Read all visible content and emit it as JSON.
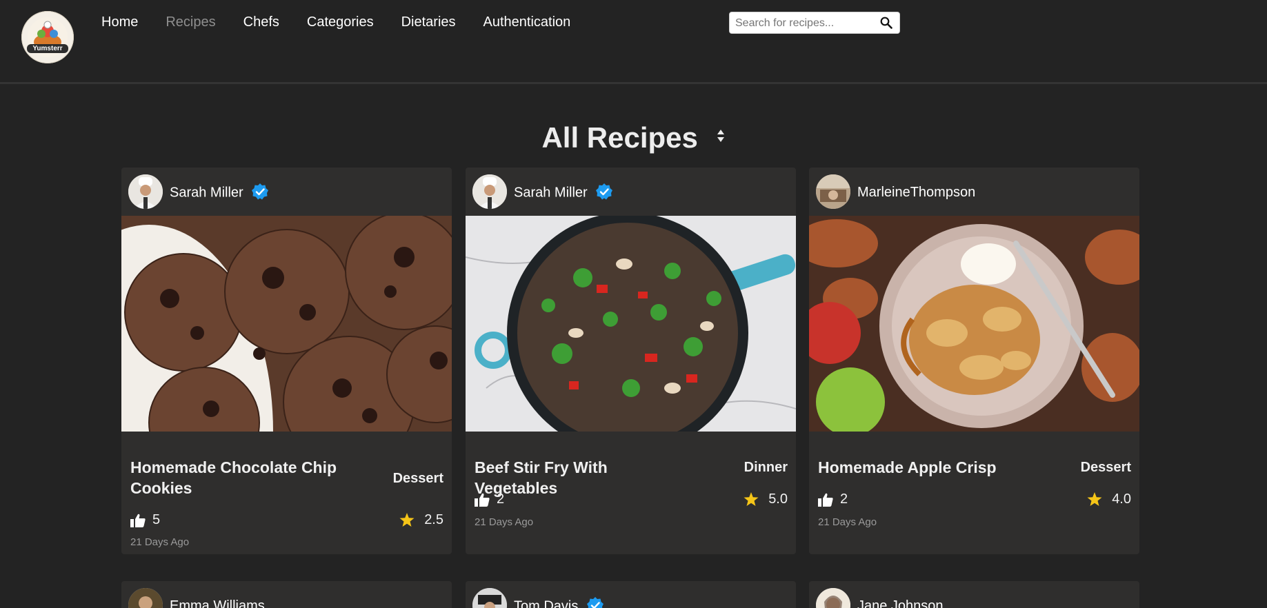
{
  "header": {
    "logo_text": "Yumsterr",
    "nav": [
      {
        "label": "Home",
        "active": false
      },
      {
        "label": "Recipes",
        "active": true
      },
      {
        "label": "Chefs",
        "active": false
      },
      {
        "label": "Categories",
        "active": false
      },
      {
        "label": "Dietaries",
        "active": false
      },
      {
        "label": "Authentication",
        "active": false
      }
    ],
    "search_placeholder": "Search for recipes..."
  },
  "main": {
    "title": "All Recipes",
    "cards": [
      {
        "chef": "Sarah Miller",
        "verified": true,
        "title": "Homemade Chocolate Chip Cookies",
        "category": "Dessert",
        "likes": "5",
        "rating": "2.5",
        "time": "21 Days Ago",
        "image": "chocolate-cookies-photo"
      },
      {
        "chef": "Sarah Miller",
        "verified": true,
        "title": "Beef Stir Fry With Vegetables",
        "category": "Dinner",
        "likes": "2",
        "rating": "5.0",
        "time": "21 Days Ago",
        "image": "beef-stir-fry-photo"
      },
      {
        "chef": "MarleineThompson",
        "verified": false,
        "title": "Homemade Apple Crisp",
        "category": "Dessert",
        "likes": "2",
        "rating": "4.0",
        "time": "21 Days Ago",
        "image": "apple-crisp-photo"
      },
      {
        "chef": "Emma Williams",
        "verified": false
      },
      {
        "chef": "Tom Davis",
        "verified": true
      },
      {
        "chef": "Jane Johnson",
        "verified": false
      }
    ]
  },
  "colors": {
    "background": "#232323",
    "card": "#2f2e2d",
    "verified": "#1d9bf0",
    "star": "#f5c518",
    "muted": "#9a9a9a"
  }
}
